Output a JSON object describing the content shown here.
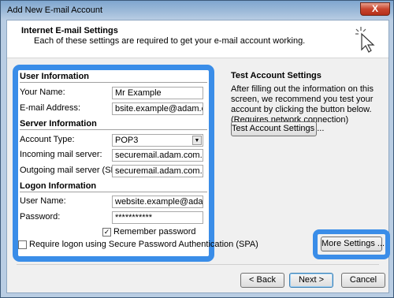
{
  "window": {
    "title": "Add New E-mail Account",
    "close_glyph": "X"
  },
  "header": {
    "title": "Internet E-mail Settings",
    "subtitle": "Each of these settings are required to get your e-mail account working."
  },
  "user_information": {
    "heading": "User Information",
    "your_name_label": "Your Name:",
    "your_name_value": "Mr Example",
    "email_label": "E-mail Address:",
    "email_value": "bsite.example@adam.com.au"
  },
  "server_information": {
    "heading": "Server Information",
    "account_type_label": "Account Type:",
    "account_type_value": "POP3",
    "incoming_label": "Incoming mail server:",
    "incoming_value": "securemail.adam.com.au",
    "outgoing_label": "Outgoing mail server (SMTP):",
    "outgoing_value": "securemail.adam.com.au"
  },
  "logon_information": {
    "heading": "Logon Information",
    "username_label": "User Name:",
    "username_value": "website.example@adam.com.",
    "password_label": "Password:",
    "password_value": "***********",
    "remember_label": "Remember password",
    "remember_checked": true,
    "spa_label": "Require logon using Secure Password Authentication (SPA)",
    "spa_checked": false
  },
  "test_settings": {
    "heading": "Test Account Settings",
    "description": "After filling out the information on this screen, we recommend you test your account by clicking the button below. (Requires network connection)",
    "test_button": "Test Account Settings ..."
  },
  "buttons": {
    "more_settings": "More Settings ...",
    "back": "< Back",
    "next": "Next >",
    "cancel": "Cancel"
  },
  "colors": {
    "highlight": "#3a8de8"
  },
  "icons": {
    "wizard": "cursor-sparkle-icon"
  }
}
